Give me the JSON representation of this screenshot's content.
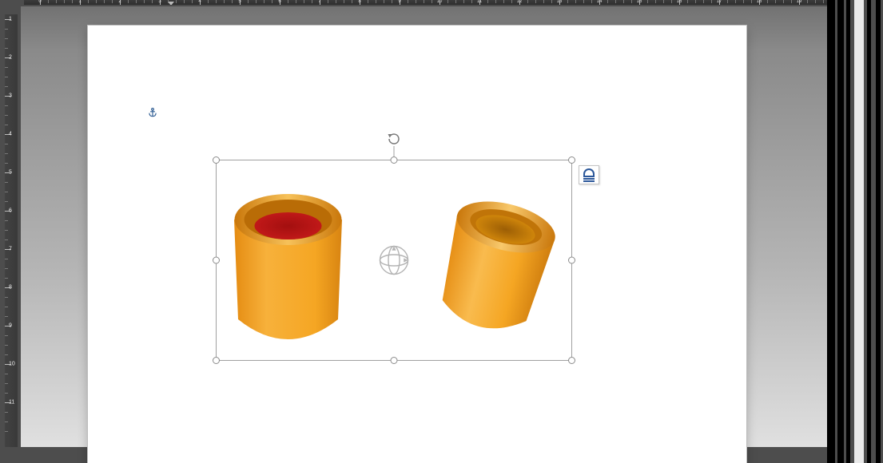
{
  "h_ruler": {
    "ticks": [
      0,
      1,
      2,
      3,
      4,
      5,
      6,
      7,
      8,
      9,
      10,
      11,
      12,
      13,
      14,
      15,
      16,
      17,
      18,
      19
    ],
    "indent_at": 3
  },
  "v_ruler": {
    "ticks": [
      1,
      2,
      3,
      4,
      5,
      6,
      7,
      8,
      9,
      10,
      11
    ]
  },
  "anchor": {
    "name": "object-anchor"
  },
  "selection": {
    "rotate_tooltip": "Rotate",
    "pan_tooltip": "3D Control",
    "layout_options_tooltip": "Layout Options"
  },
  "model": {
    "shapes": [
      {
        "kind": "cylinder",
        "fill": "#f5a623",
        "inner": "#c21919"
      },
      {
        "kind": "cylinder",
        "fill": "#f5a623",
        "inner": "#d98d0c"
      }
    ]
  }
}
